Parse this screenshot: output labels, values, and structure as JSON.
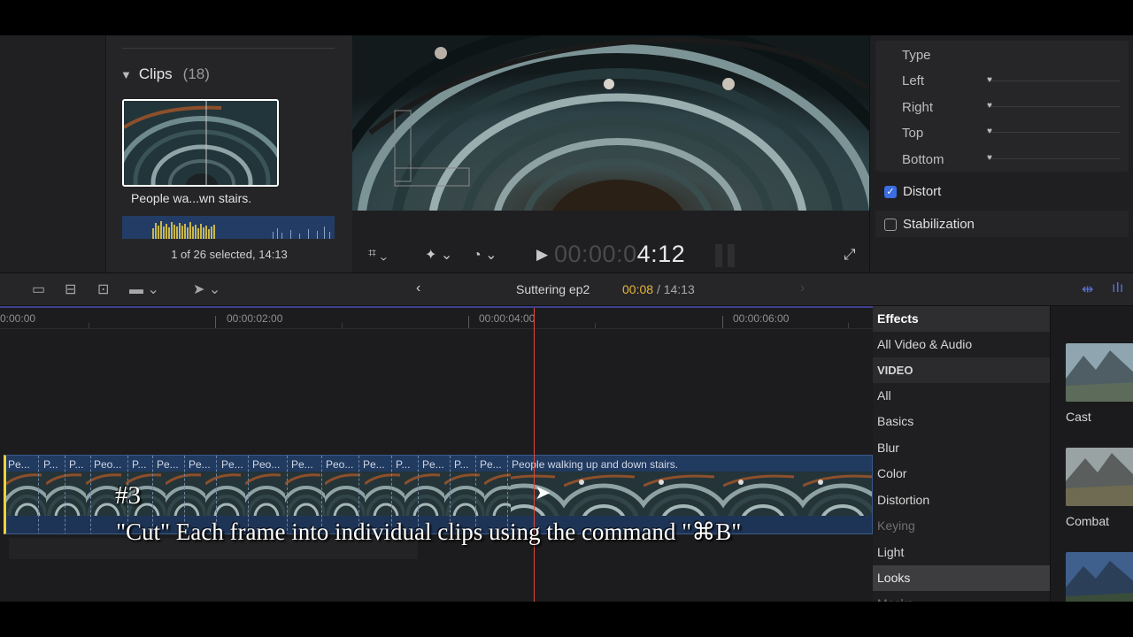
{
  "browser": {
    "section_title": "Clips",
    "section_count": "(18)",
    "clip_name": "People wa...wn stairs.",
    "selection_status": "1 of 26 selected, 14:13"
  },
  "viewer": {
    "timecode_dim": "00:00:0",
    "timecode_bright": "4:12"
  },
  "inspector": {
    "rows": [
      "Type",
      "Left",
      "Right",
      "Top",
      "Bottom"
    ],
    "distort_label": "Distort",
    "distort_checked": true,
    "stabilization_label": "Stabilization",
    "stabilization_checked": false
  },
  "toolbar": {
    "project_name": "Suttering ep2",
    "current_time": "00:08",
    "total_time": "/ 14:13"
  },
  "timeline": {
    "ruler_labels": [
      "0:00:00",
      "00:00:02:00",
      "00:00:04:00",
      "00:00:06:00"
    ],
    "short_clip_labels": [
      "Pe...",
      "P...",
      "P...",
      "Peo...",
      "P...",
      "Pe...",
      "Pe...",
      "Pe...",
      "Peo...",
      "Pe...",
      "Peo...",
      "Pe...",
      "P...",
      "Pe...",
      "P...",
      "Pe..."
    ],
    "long_clip_label": "People walking up and down stairs."
  },
  "caption": {
    "number": "#3",
    "text": "\"Cut\" Each frame into individual  clips using the command \"⌘B\""
  },
  "effects": {
    "header": "Effects",
    "all_video_audio": "All Video & Audio",
    "section_video": "VIDEO",
    "items": [
      "All",
      "Basics",
      "Blur",
      "Color",
      "Distortion",
      "Keying",
      "Light",
      "Looks",
      "Masks"
    ],
    "selected": "Looks",
    "thumbs": [
      "Cast",
      "Combat"
    ]
  },
  "colors": {
    "accent_blue": "#3b6ee0",
    "playhead": "#e04a3a",
    "timecode_yellow": "#e5b53a",
    "clip_blue": "#1e3456"
  }
}
